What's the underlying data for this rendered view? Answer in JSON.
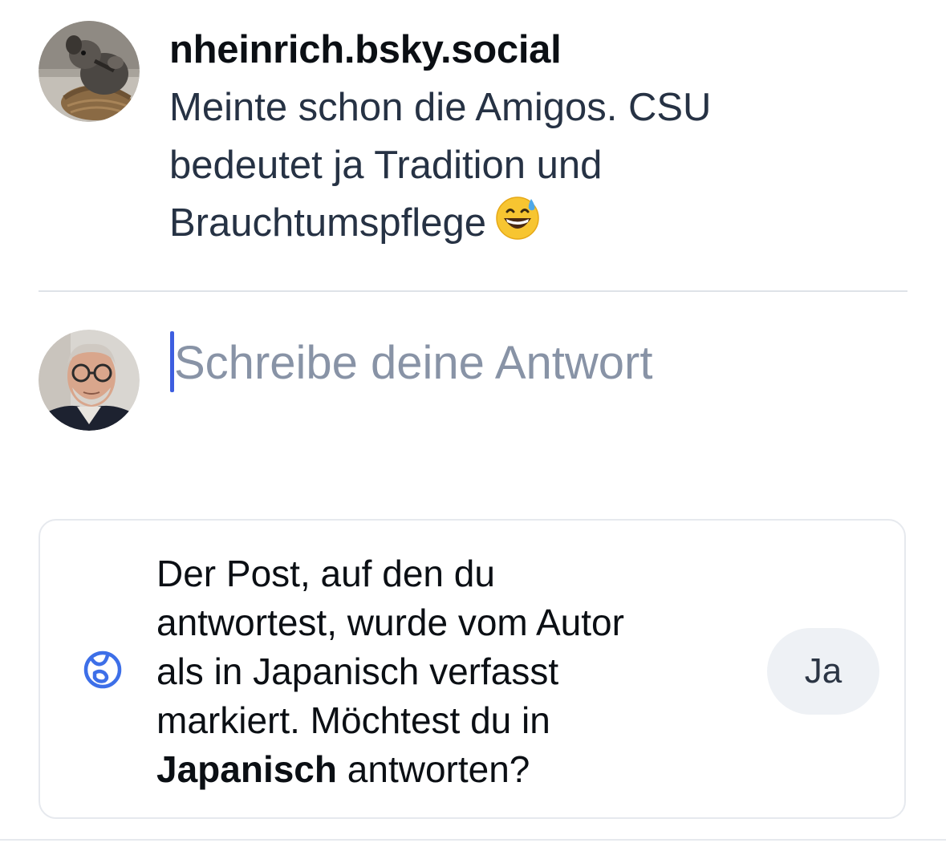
{
  "parent_post": {
    "author_handle": "nheinrich.bsky.social",
    "avatar_icon": "dog-in-basket-avatar",
    "text_lines": [
      "Meinte schon die Amigos. CSU",
      "bedeutet ja Tradition und",
      "Brauchtumspflege"
    ],
    "emoji": "grinning-face-with-sweat"
  },
  "composer": {
    "avatar_icon": "user-avatar-man-glasses",
    "placeholder": "Schreibe deine Antwort",
    "value": ""
  },
  "language_prompt": {
    "icon": "globe-icon",
    "text_lines": [
      "Der Post, auf den du",
      "antwortest, wurde vom Autor",
      "als in Japanisch verfasst",
      "markiert. Möchtest du in"
    ],
    "language_bold": "Japanisch",
    "text_tail": " antworten?",
    "button_label": "Ja"
  },
  "colors": {
    "accent": "#3d5ee0",
    "placeholder": "#8893a6",
    "text": "#263244",
    "divider": "#dfe3e8",
    "button_bg": "#eef1f5"
  }
}
